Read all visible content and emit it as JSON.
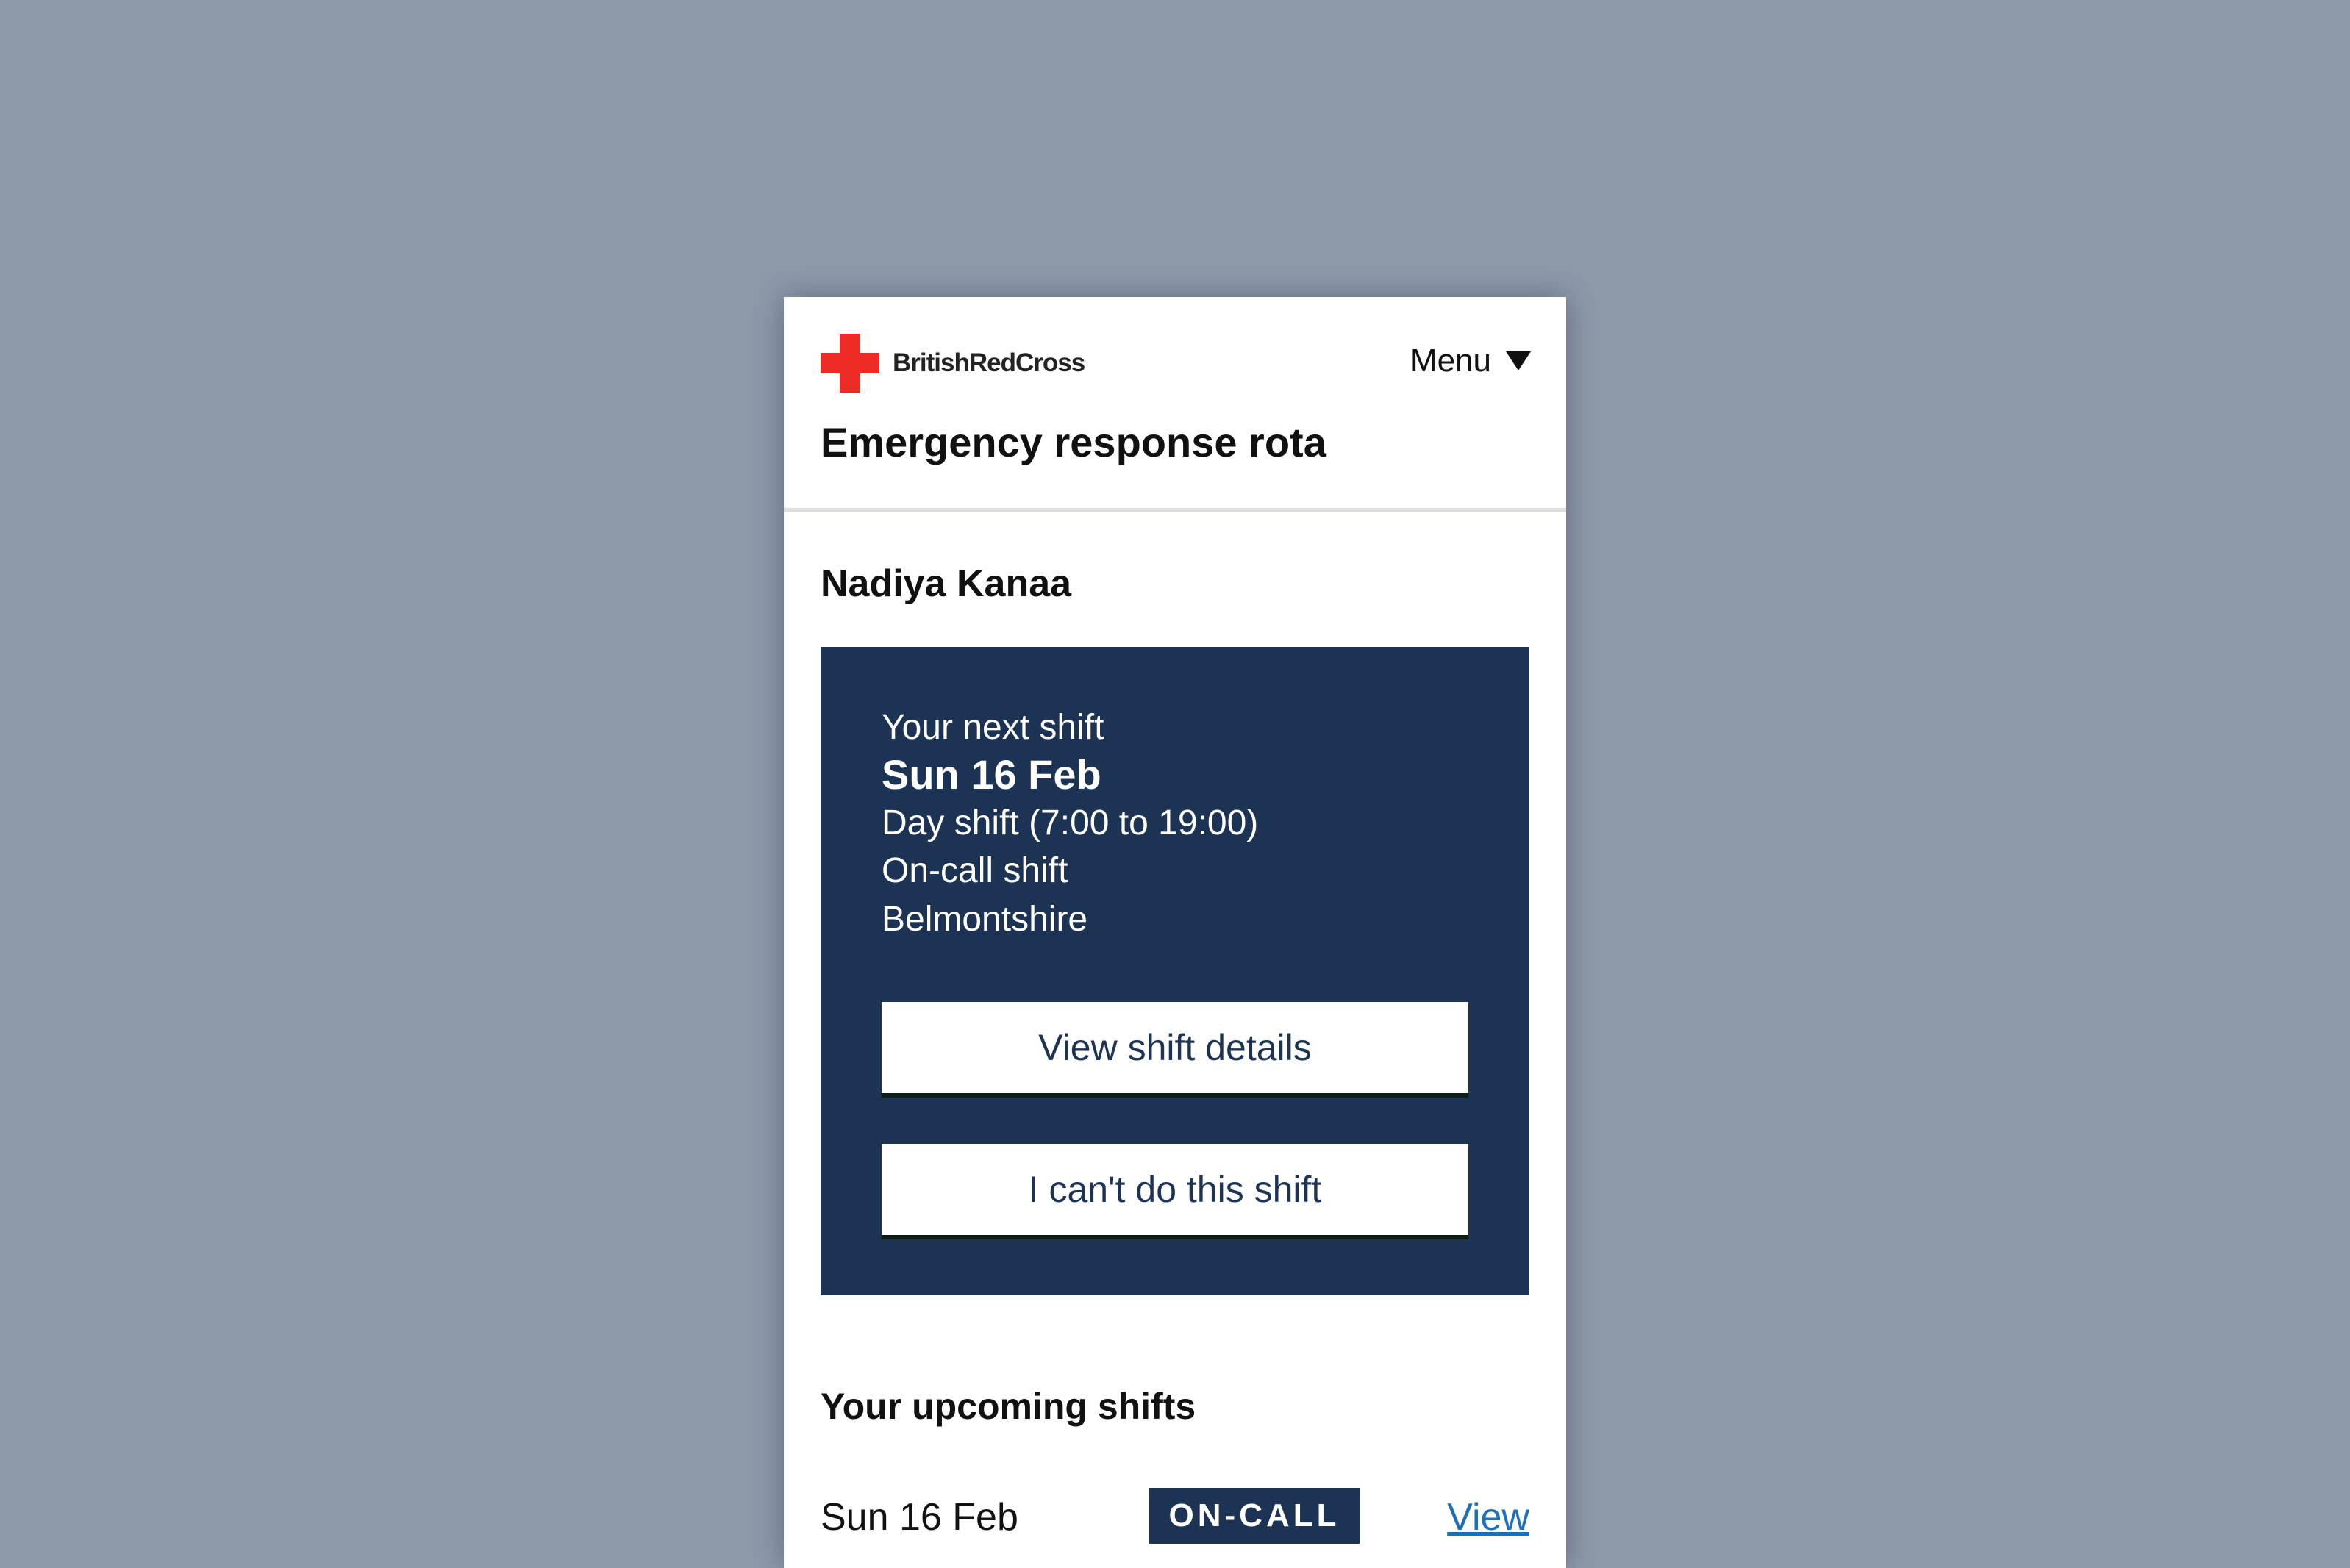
{
  "header": {
    "brand": "BritishRedCross",
    "menu_label": "Menu",
    "page_title": "Emergency response rota"
  },
  "user": {
    "name": "Nadiya Kanaa"
  },
  "next_shift": {
    "label": "Your next shift",
    "date": "Sun 16 Feb",
    "time": "Day shift (7:00 to 19:00)",
    "type": "On-call shift",
    "location": "Belmontshire",
    "view_button": "View shift details",
    "decline_button": "I can't do this shift"
  },
  "upcoming": {
    "title": "Your upcoming shifts",
    "shifts": [
      {
        "date": "Sun 16 Feb",
        "badge": "ON-CALL",
        "link": "View"
      }
    ]
  },
  "icons": {
    "logo": "red-cross-icon",
    "menu": "caret-down-icon"
  },
  "colors": {
    "background": "#8e9aaa",
    "brand_red": "#ee2a24",
    "navy": "#1c3354",
    "link_blue": "#1d70b8"
  }
}
